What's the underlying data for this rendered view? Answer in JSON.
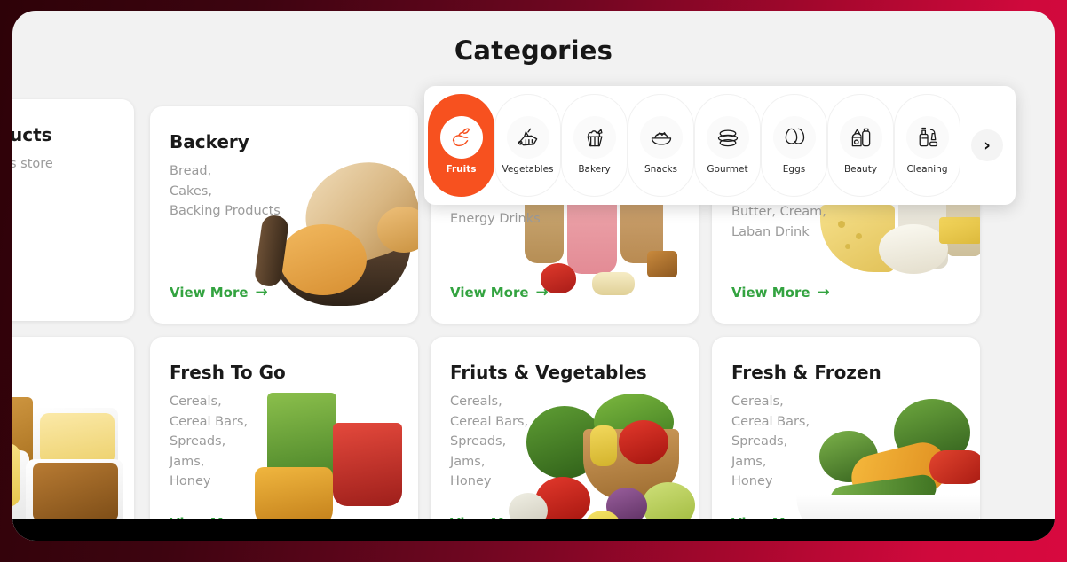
{
  "page": {
    "title": "Categories",
    "accent_orange": "#f7511f",
    "link_green": "#33a340",
    "frame_gradient_from": "#2e0208",
    "frame_gradient_to": "#d8093f",
    "page_background": "#f2f2f2"
  },
  "cards": [
    {
      "id": "card-products",
      "title": "ucts",
      "subtitle": "s store",
      "view_more": "",
      "partially_visible": true
    },
    {
      "id": "card-backery",
      "title": "Backery",
      "subtitle": "Bread,\nCakes,\nBacking Products",
      "view_more": "View More"
    },
    {
      "id": "card-beverages",
      "title": "",
      "subtitle": "Energy Drinks",
      "view_more": "View More",
      "occluded_by_panel": true
    },
    {
      "id": "card-dairy",
      "title": "",
      "subtitle": "Butter, Cream,\nLaban Drink",
      "view_more": "View More",
      "occluded_by_panel": true
    },
    {
      "id": "card-snacks-partial",
      "title": "",
      "subtitle": "",
      "view_more": "",
      "partially_visible": true
    },
    {
      "id": "card-fresh-to-go",
      "title": "Fresh To Go",
      "subtitle": "Cereals,\nCereal Bars,\nSpreads,\nJams,\nHoney",
      "view_more": "View More"
    },
    {
      "id": "card-fruits-vegetables",
      "title": "Friuts & Vegetables",
      "subtitle": "Cereals,\nCereal Bars,\nSpreads,\nJams,\nHoney",
      "view_more": "View More"
    },
    {
      "id": "card-fresh-frozen",
      "title": "Fresh & Frozen",
      "subtitle": "Cereals,\nCereal Bars,\nSpreads,\nJams,\nHoney",
      "view_more": "View More"
    }
  ],
  "category_selector": {
    "next_icon": "chevron-right-icon",
    "items": [
      {
        "label": "Fruits",
        "icon": "fruits-icon",
        "active": true
      },
      {
        "label": "Vegetables",
        "icon": "vegetables-icon",
        "active": false
      },
      {
        "label": "Bakery",
        "icon": "cupcake-icon",
        "active": false
      },
      {
        "label": "Snacks",
        "icon": "snacks-bowl-icon",
        "active": false
      },
      {
        "label": "Gourmet",
        "icon": "gourmet-icon",
        "active": false
      },
      {
        "label": "Eggs",
        "icon": "eggs-icon",
        "active": false
      },
      {
        "label": "Beauty",
        "icon": "beauty-icon",
        "active": false
      },
      {
        "label": "Cleaning",
        "icon": "cleaning-icon",
        "active": false
      }
    ]
  }
}
